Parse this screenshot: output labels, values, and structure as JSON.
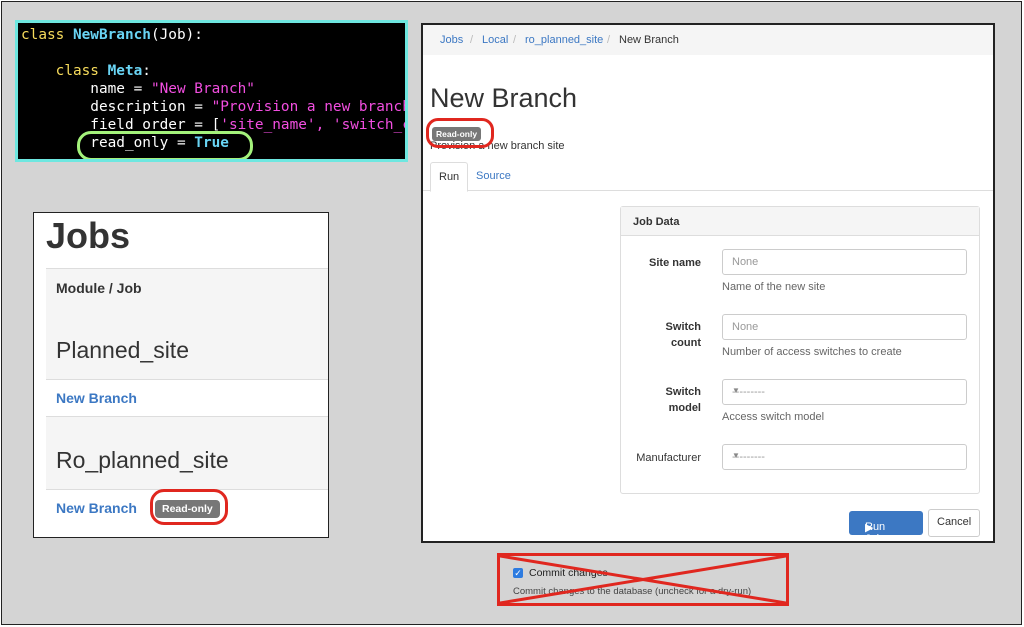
{
  "code": {
    "line1": {
      "kw": "class ",
      "cls": "NewBranch",
      "rest": "(Job):"
    },
    "line2": {
      "indent": "    ",
      "kw": "class ",
      "cls": "Meta",
      "rest": ":"
    },
    "line3": {
      "pre": "        name = ",
      "str": "\"New Branch\""
    },
    "line4": {
      "pre": "        description = ",
      "str": "\"Provision a new branch"
    },
    "line5": {
      "pre": "        field_order = [",
      "str": "'site_name', 'switch_c"
    },
    "line6": {
      "pre": "        read_only = ",
      "val": "True"
    }
  },
  "jobs_list": {
    "title": "Jobs",
    "column_header": "Module / Job",
    "groups": [
      {
        "name": "Planned_site",
        "job": "New Branch",
        "badge": ""
      },
      {
        "name": "Ro_planned_site",
        "job": "New Branch",
        "badge": "Read-only"
      }
    ]
  },
  "breadcrumb": {
    "items": [
      "Jobs",
      "Local",
      "ro_planned_site"
    ],
    "current": "New Branch",
    "sep": "/"
  },
  "job_page": {
    "title": "New Branch",
    "badge": "Read-only",
    "description": "Provision a new branch site",
    "tabs": [
      "Run",
      "Source"
    ],
    "panel_title": "Job Data",
    "fields": {
      "site_name": {
        "label": "Site name",
        "placeholder": "None",
        "help": "Name of the new site"
      },
      "switch_count": {
        "label1": "Switch",
        "label2": "count",
        "placeholder": "None",
        "help": "Number of access switches to create"
      },
      "switch_model": {
        "label1": "Switch",
        "label2": "model",
        "value": "---------",
        "help": "Access switch model"
      },
      "manufacturer": {
        "label": "Manufacturer",
        "value": "---------"
      }
    },
    "run_button": "Run Job",
    "cancel_button": "Cancel"
  },
  "commit": {
    "checked": true,
    "label": "Commit changes",
    "help": "Commit changes to the database (uncheck for a dry-run)"
  },
  "colors": {
    "highlight_red": "#e0271f",
    "highlight_green": "#a4f27b",
    "link_blue": "#3c78c3",
    "badge_gray": "#777777"
  }
}
